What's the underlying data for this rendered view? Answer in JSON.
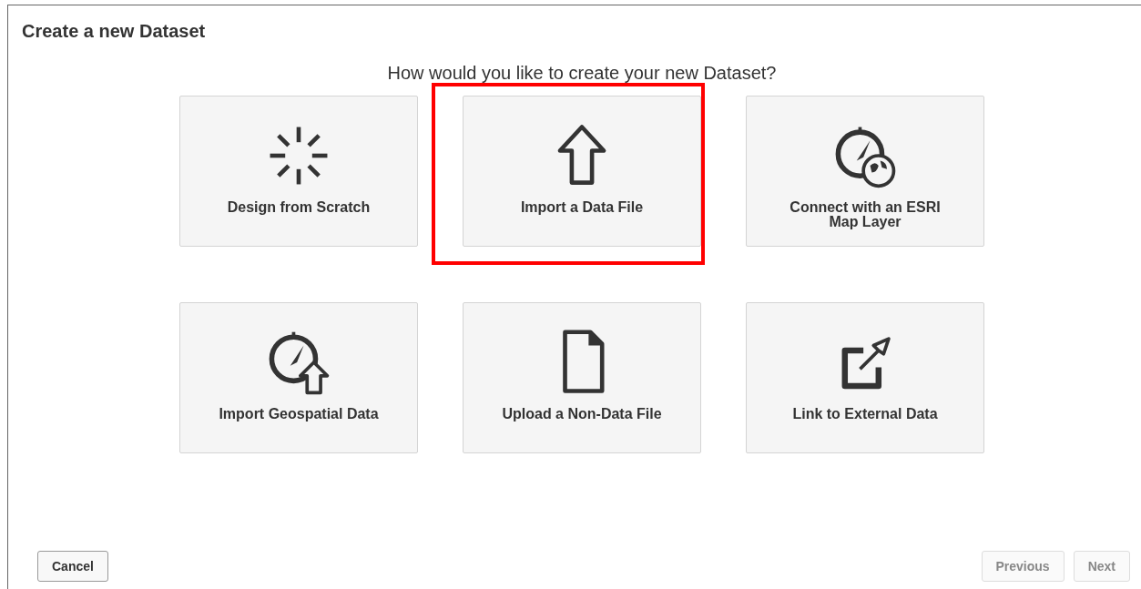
{
  "dialog": {
    "title": "Create a new Dataset",
    "question": "How would you like to create your new Dataset?"
  },
  "options": [
    {
      "kind": "burst",
      "label": "Design from Scratch",
      "highlighted": false
    },
    {
      "kind": "upload",
      "label": "Import a Data File",
      "highlighted": true
    },
    {
      "kind": "globe",
      "label": "Connect with an ESRI Map Layer",
      "highlighted": false
    },
    {
      "kind": "geoupload",
      "label": "Import Geospatial Data",
      "highlighted": false
    },
    {
      "kind": "file",
      "label": "Upload a Non-Data File",
      "highlighted": false
    },
    {
      "kind": "external",
      "label": "Link to External Data",
      "highlighted": false
    }
  ],
  "footer": {
    "left_buttons": [
      {
        "label": "Cancel",
        "disabled": false
      }
    ],
    "right_buttons": [
      {
        "label": "Previous",
        "disabled": true
      },
      {
        "label": "Next",
        "disabled": true
      }
    ]
  }
}
